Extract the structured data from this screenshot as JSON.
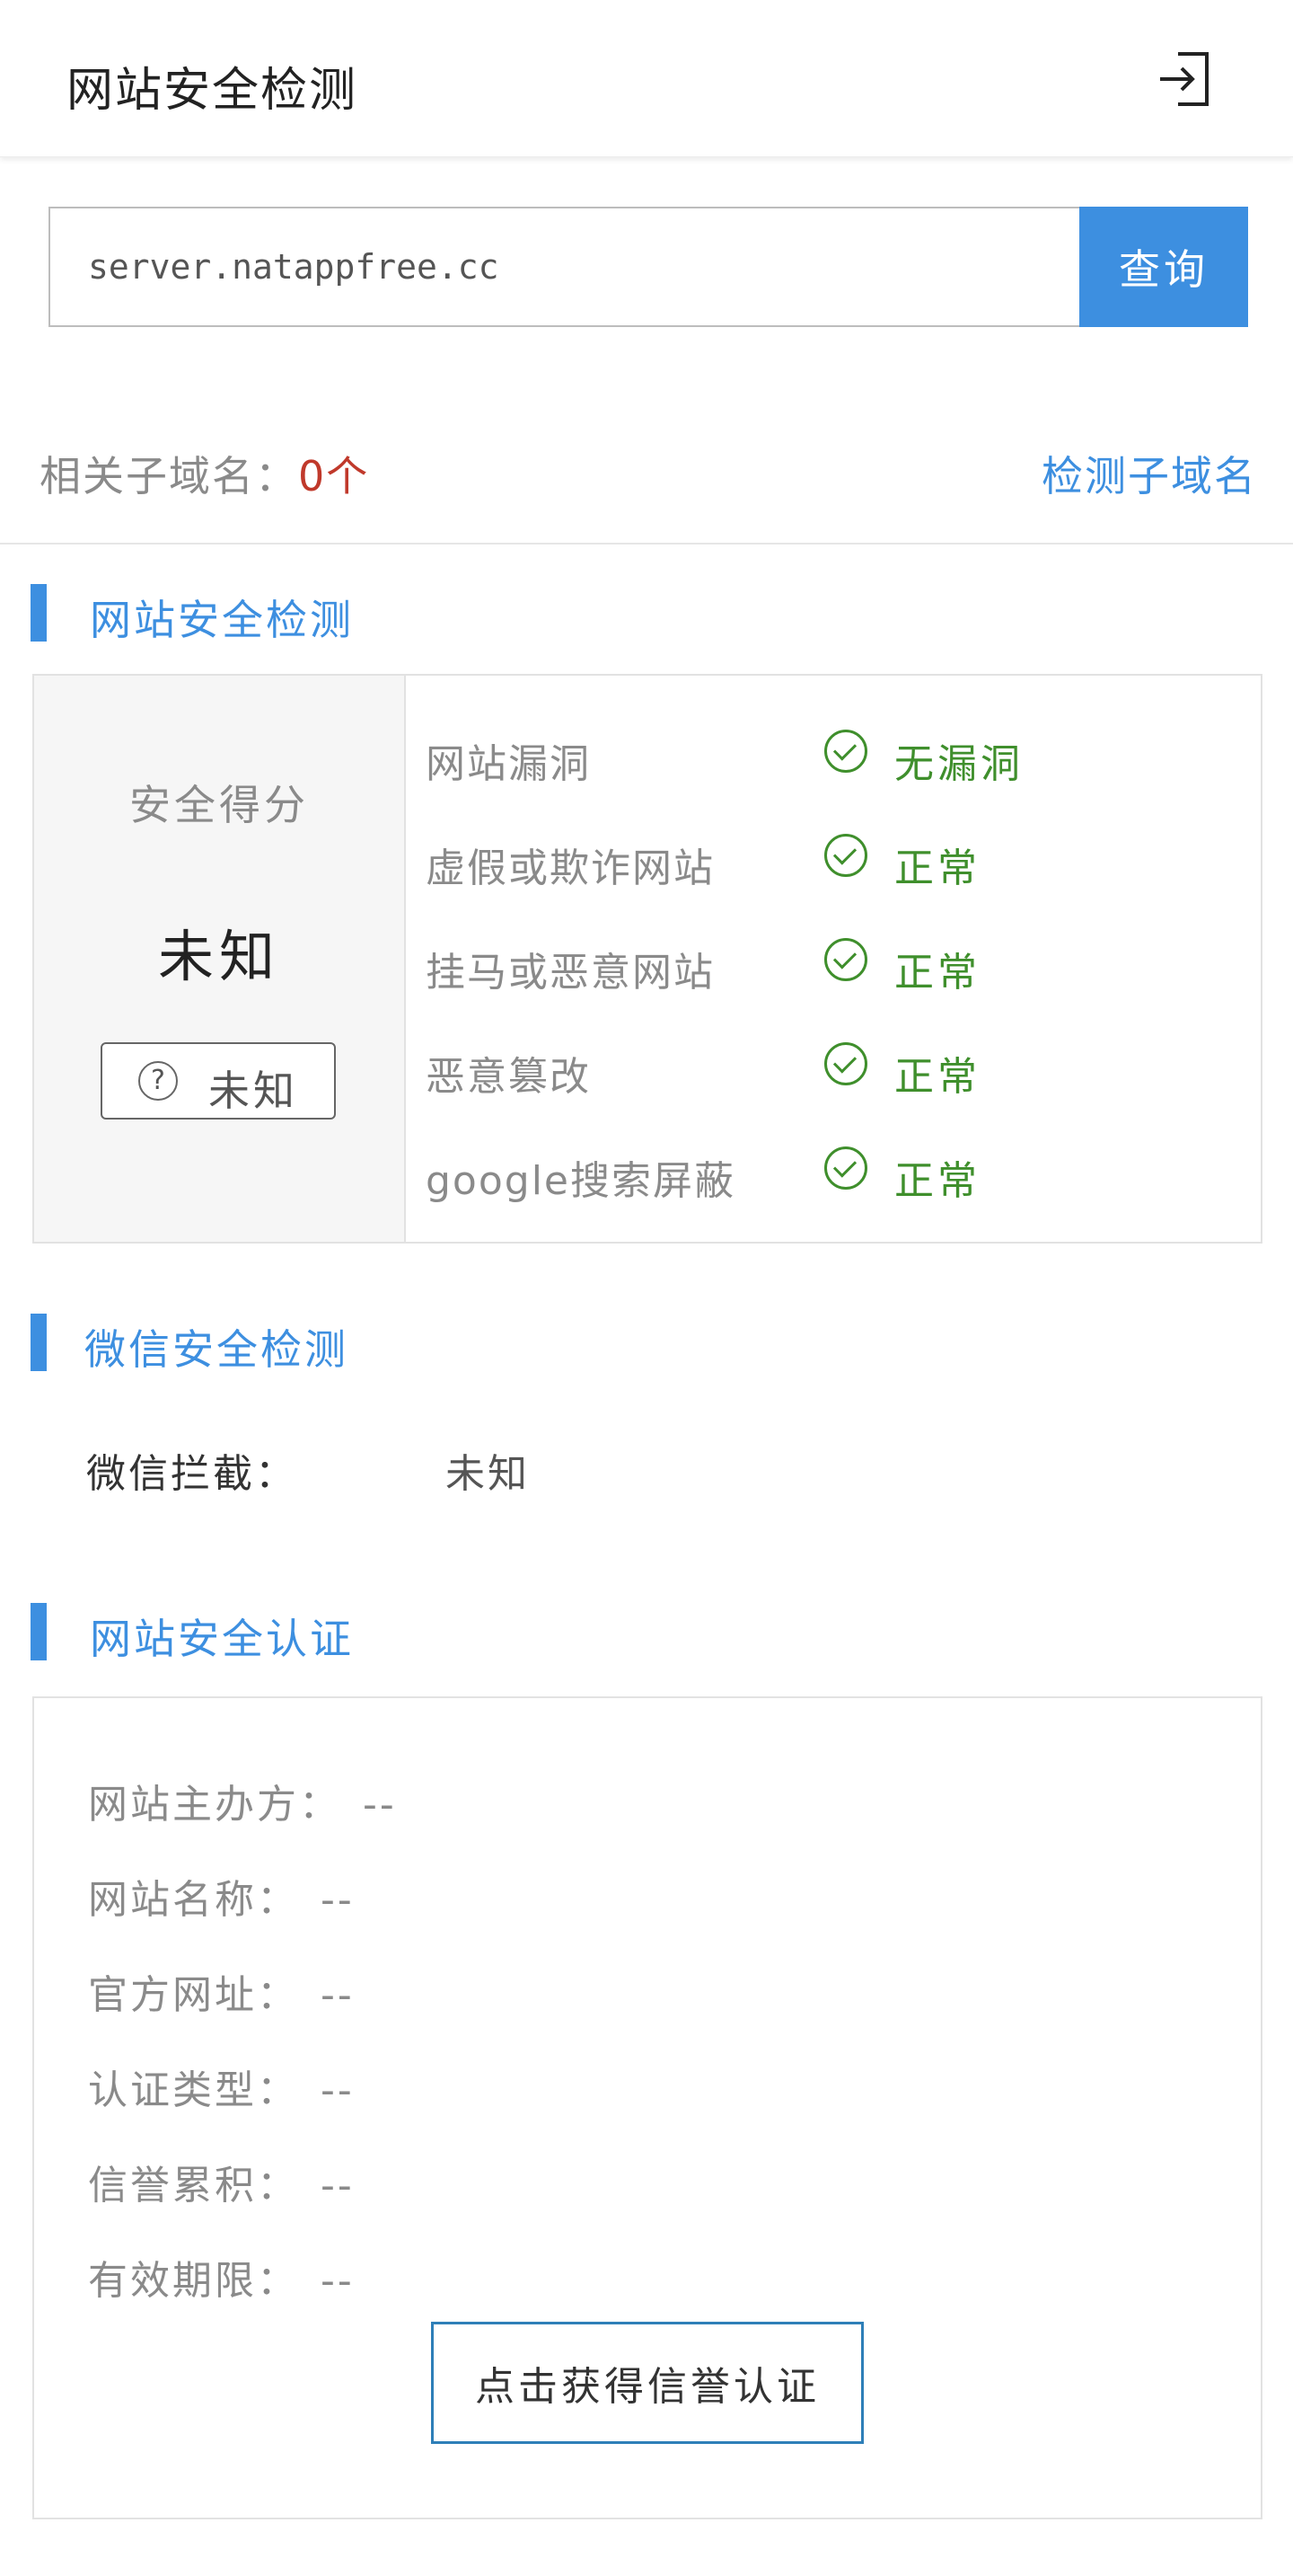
{
  "header": {
    "title": "网站安全检测",
    "exit_icon": "exit-icon"
  },
  "search": {
    "value": "server.natappfree.cc",
    "button_label": "查询"
  },
  "subdomain": {
    "label": "相关子域名：",
    "count": "0个",
    "link_label": "检测子域名"
  },
  "site_security": {
    "title": "网站安全检测",
    "score_label": "安全得分",
    "score_value": "未知",
    "badge_label": "未知",
    "checks": [
      {
        "label": "网站漏洞",
        "status": "无漏洞"
      },
      {
        "label": "虚假或欺诈网站",
        "status": "正常"
      },
      {
        "label": "挂马或恶意网站",
        "status": "正常"
      },
      {
        "label": "恶意篡改",
        "status": "正常"
      },
      {
        "label": "google搜索屏蔽",
        "status": "正常"
      }
    ]
  },
  "wechat_security": {
    "title": "微信安全检测",
    "label": "微信拦截：",
    "value": "未知"
  },
  "certification": {
    "title": "网站安全认证",
    "rows": [
      {
        "label": "网站主办方：",
        "value": "--"
      },
      {
        "label": "网站名称：",
        "value": "--"
      },
      {
        "label": "官方网址：",
        "value": "--"
      },
      {
        "label": "认证类型：",
        "value": "--"
      },
      {
        "label": "信誉累积：",
        "value": "--"
      },
      {
        "label": "有效期限：",
        "value": "--"
      }
    ],
    "button_label": "点击获得信誉认证"
  },
  "colors": {
    "accent": "#3d8fe0",
    "ok": "#3f8f2c",
    "alert": "#c0392b"
  }
}
